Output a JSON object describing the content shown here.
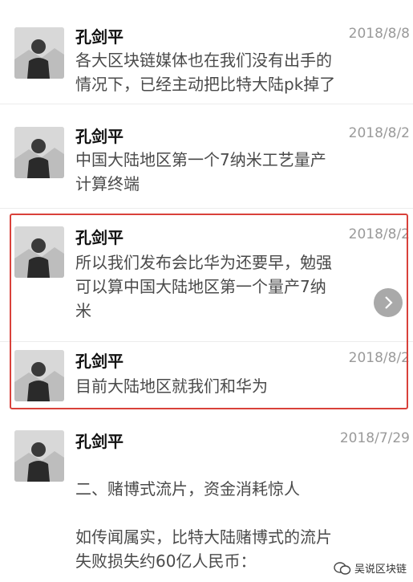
{
  "messages": [
    {
      "sender": "孔剑平",
      "date": "2018/8/8",
      "lines": [
        "各大区块链媒体也在我们没有出手的",
        "情况下，已经主动把比特大陆pk掉了"
      ]
    },
    {
      "sender": "孔剑平",
      "date": "2018/8/2",
      "lines": [
        "中国大陆地区第一个7纳米工艺量产",
        "计算终端"
      ]
    },
    {
      "sender": "孔剑平",
      "date": "2018/8/2",
      "lines": [
        "所以我们发布会比华为还要早，勉强",
        "可以算中国大陆地区第一个量产7纳",
        "米"
      ]
    },
    {
      "sender": "孔剑平",
      "date": "2018/8/2",
      "lines": [
        "目前大陆地区就我们和华为"
      ]
    },
    {
      "sender": "孔剑平",
      "date": "2018/7/29",
      "lines": [
        "二、赌博式流片，资金消耗惊人",
        "",
        "如传闻属实，比特大陆赌博式的流片",
        "失败损失约60亿人民币："
      ]
    }
  ],
  "watermark": {
    "text": "吴说区块链",
    "icon": "wechat-icon"
  },
  "colors": {
    "highlight": "#d9413a",
    "sender": "#111111",
    "date": "#9a9a9a",
    "body": "#4a4a4a"
  }
}
